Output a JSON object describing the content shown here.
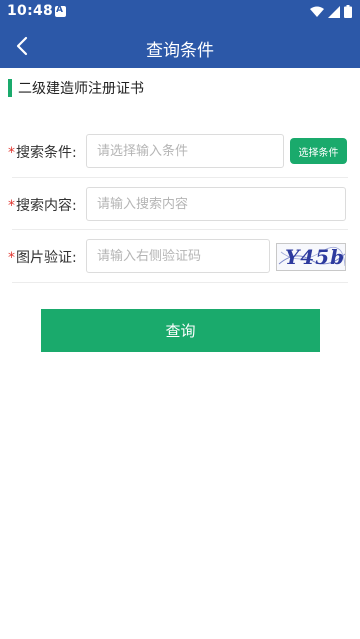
{
  "status_bar": {
    "time": "10:48",
    "notification_icon": "a-icon",
    "icons": [
      "wifi-icon",
      "signal-icon",
      "battery-icon"
    ]
  },
  "nav": {
    "back_icon": "chevron-left-icon",
    "title": "查询条件"
  },
  "section": {
    "title": "二级建造师注册证书"
  },
  "form": {
    "condition": {
      "required_mark": "*",
      "label": "搜索条件:",
      "value": "",
      "placeholder": "请选择输入条件",
      "button_label": "选择条件"
    },
    "content": {
      "required_mark": "*",
      "label": "搜索内容:",
      "value": "",
      "placeholder": "请输入搜索内容"
    },
    "captcha": {
      "required_mark": "*",
      "label": "图片验证:",
      "value": "",
      "placeholder": "请输入右侧验证码",
      "image_text": "Y45b"
    }
  },
  "submit_label": "查询",
  "colors": {
    "primary_blue": "#2c58a8",
    "accent_green": "#1aaa6c",
    "required_red": "#e0362f"
  }
}
